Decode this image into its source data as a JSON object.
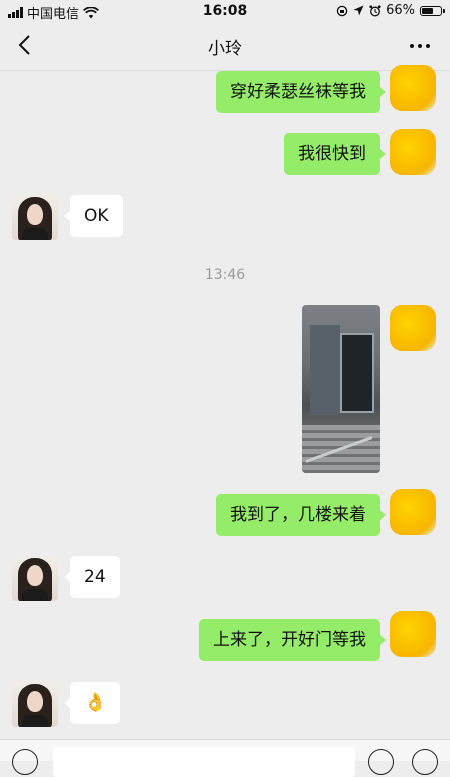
{
  "status_bar": {
    "carrier": "中国电信",
    "time": "16:08",
    "battery": "66%",
    "battery_level": 0.66
  },
  "header": {
    "title": "小玲"
  },
  "messages": [
    {
      "from": "me",
      "type": "text",
      "text": "穿好柔瑟丝袜等我"
    },
    {
      "from": "me",
      "type": "text",
      "text": "我很快到"
    },
    {
      "from": "them",
      "type": "text",
      "text": "OK"
    },
    {
      "type": "time",
      "text": "13:46"
    },
    {
      "from": "me",
      "type": "image"
    },
    {
      "from": "me",
      "type": "text",
      "text": "我到了，几楼来着"
    },
    {
      "from": "them",
      "type": "text",
      "text": "24"
    },
    {
      "from": "me",
      "type": "text",
      "text": "上来了，开好门等我"
    },
    {
      "from": "them",
      "type": "emoji",
      "icon": "ok-hand-emoji",
      "text": "👌"
    }
  ],
  "colors": {
    "my_bubble": "#95ec69",
    "their_bubble": "#ffffff",
    "background": "#ededed"
  }
}
